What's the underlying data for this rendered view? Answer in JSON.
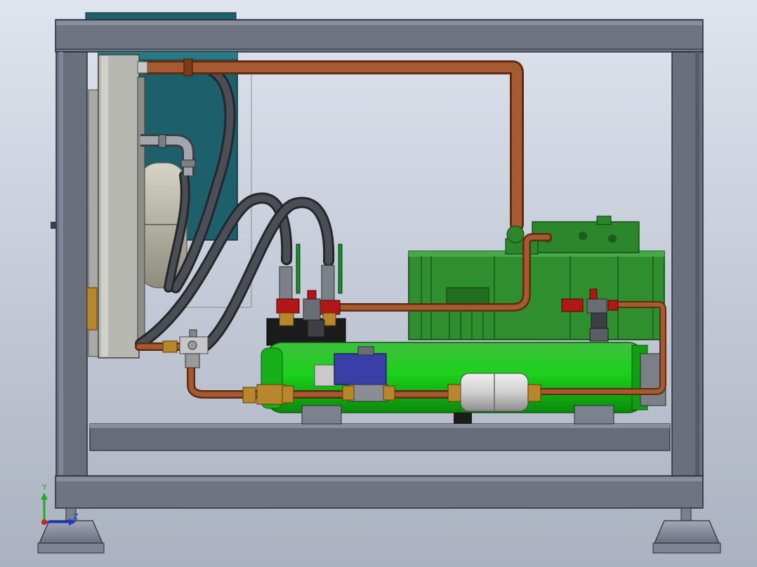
{
  "view": {
    "background_top": "#dfe4ee",
    "background_bottom": "#aab1c0"
  },
  "triad": {
    "y_label": "Y",
    "z_label": "Z",
    "y_color": "#22aa22",
    "z_color": "#1a3acc",
    "origin_color": "#cc2222"
  },
  "colors": {
    "frame": "#6f7482",
    "frame_dark": "#3a3e49",
    "frame_light": "#858a98",
    "copper": "#a75a2f",
    "copper_dark": "#5e2c12",
    "hose": "#3d3f44",
    "compressor": "#2f8f2f",
    "compressor_dark": "#175c17",
    "receiver": "#1ec21e",
    "receiver_dark": "#0d7a0d",
    "tank": "#1d5f6a",
    "condenser": "#b7b8b2",
    "brass": "#b8862b",
    "valve_red": "#b01818",
    "solenoid": "#3a3fa8",
    "filter": "#c9c9c9",
    "handle": "#1a8a2a"
  }
}
